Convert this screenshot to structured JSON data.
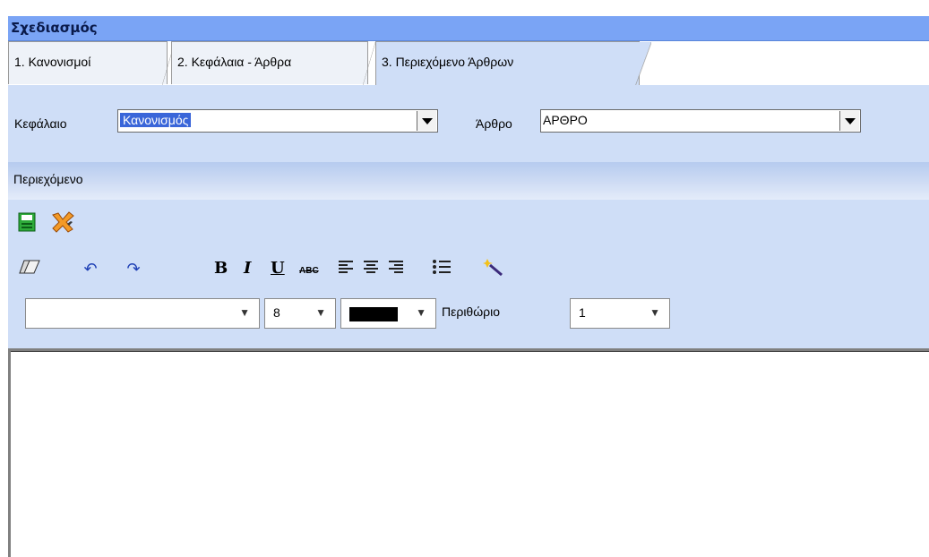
{
  "window": {
    "title": "Σχεδιασμός"
  },
  "tabs": [
    {
      "label": "1. Κανονισμοί",
      "active": false
    },
    {
      "label": "2. Κεφάλαια - Άρθρα",
      "active": false
    },
    {
      "label": "3. Περιεχόμενο Άρθρων",
      "active": true
    }
  ],
  "form": {
    "chapter_label": "Κεφάλαιο",
    "chapter_value": "Κανονισμός",
    "article_label": "Άρθρο",
    "article_value": "ΑΡΘΡΟ"
  },
  "content_header": "Περιεχόμενο",
  "toolbar_actions": {
    "save_icon": "save-icon",
    "cancel_icon": "cancel-icon"
  },
  "format_toolbar": {
    "bold": "B",
    "italic": "I",
    "underline": "U",
    "strike": "ABC"
  },
  "font_row": {
    "font_family_value": "",
    "font_size_value": "8",
    "color_value": "#000000",
    "margin_label": "Περιθώριο",
    "margin_value": "1"
  },
  "colors": {
    "title_bar": "#7aa4f5",
    "panel": "#cfdef7",
    "selection": "#3a66d9"
  }
}
